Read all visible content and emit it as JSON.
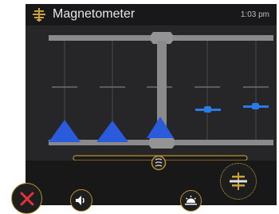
{
  "titlebar": {
    "title": "Magnetometer",
    "time": "1:03 pm",
    "icon": "magnetometer-icon"
  },
  "controls": {
    "close": "close-icon",
    "sound": "speaker-icon",
    "light": "sunrise-icon",
    "magnet": "magnetometer-icon",
    "slider_icon": "spring-icon"
  },
  "colors": {
    "accent": "#b8902e",
    "close_red": "#e2323a",
    "signal_blue": "#2a5bdc",
    "rail_gray": "#8a8a8a"
  }
}
